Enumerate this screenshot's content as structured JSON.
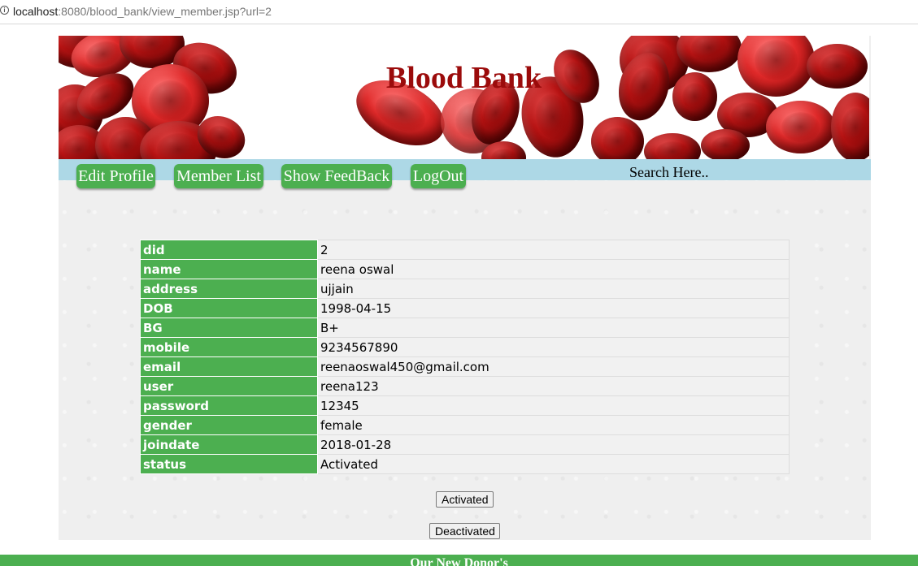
{
  "browser": {
    "url_host": "localhost",
    "url_rest": ":8080/blood_bank/view_member.jsp?url=2"
  },
  "header": {
    "title": "Blood Bank"
  },
  "nav": {
    "edit_profile": "Edit Profile",
    "member_list": "Member List",
    "show_feedback": "Show FeedBack",
    "logout": "LogOut",
    "search": "Search Here.."
  },
  "member": {
    "rows": [
      {
        "key": "did",
        "value": "2"
      },
      {
        "key": "name",
        "value": "reena oswal"
      },
      {
        "key": "address",
        "value": "ujjain"
      },
      {
        "key": "DOB",
        "value": "1998-04-15"
      },
      {
        "key": "BG",
        "value": "B+"
      },
      {
        "key": "mobile",
        "value": "9234567890"
      },
      {
        "key": "email",
        "value": "reenaoswal450@gmail.com"
      },
      {
        "key": "user",
        "value": "reena123"
      },
      {
        "key": "password",
        "value": "12345"
      },
      {
        "key": "gender",
        "value": "female"
      },
      {
        "key": "joindate",
        "value": "2018-01-28"
      },
      {
        "key": "status",
        "value": "Activated"
      }
    ]
  },
  "actions": {
    "activate_label": "Activated",
    "deactivate_label": "Deactivated"
  },
  "footer": {
    "title": "Our New Donor's"
  },
  "colors": {
    "nav_bg": "#add8e6",
    "button_green": "#4caf50",
    "title_red": "#9b0b0b"
  }
}
